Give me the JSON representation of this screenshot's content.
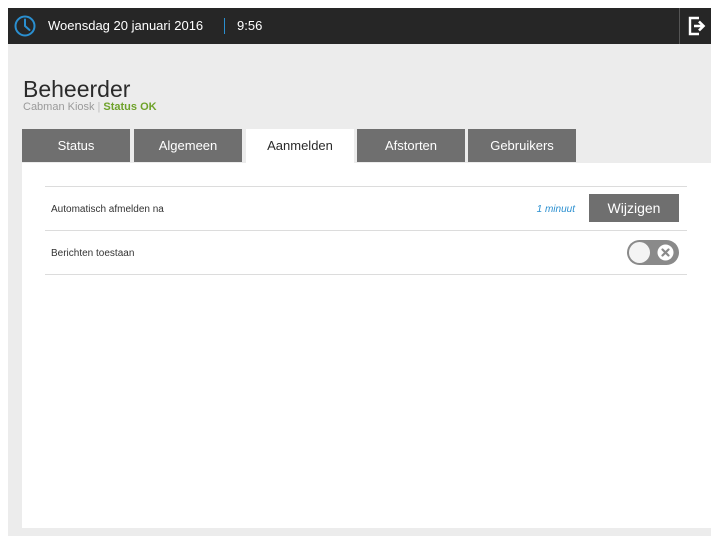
{
  "header": {
    "date": "Woensdag 20 januari 2016",
    "time": "9:56",
    "clock_icon": "clock-icon",
    "logout_icon": "logout-icon",
    "accent_color": "#2a8fd0"
  },
  "page": {
    "title": "Beheerder",
    "device": "Cabman Kiosk",
    "separator": "|",
    "status": "Status OK",
    "status_color": "#6ea22a"
  },
  "tabs": [
    {
      "label": "Status",
      "active": false
    },
    {
      "label": "Algemeen",
      "active": false
    },
    {
      "label": "Aanmelden",
      "active": true
    },
    {
      "label": "Afstorten",
      "active": false
    },
    {
      "label": "Gebruikers",
      "active": false
    }
  ],
  "settings": {
    "auto_logout": {
      "label": "Automatisch afmelden na",
      "value": "1 minuut",
      "button_label": "Wijzigen"
    },
    "messages": {
      "label": "Berichten toestaan",
      "enabled": false,
      "toggle_icon": "close-icon"
    }
  }
}
